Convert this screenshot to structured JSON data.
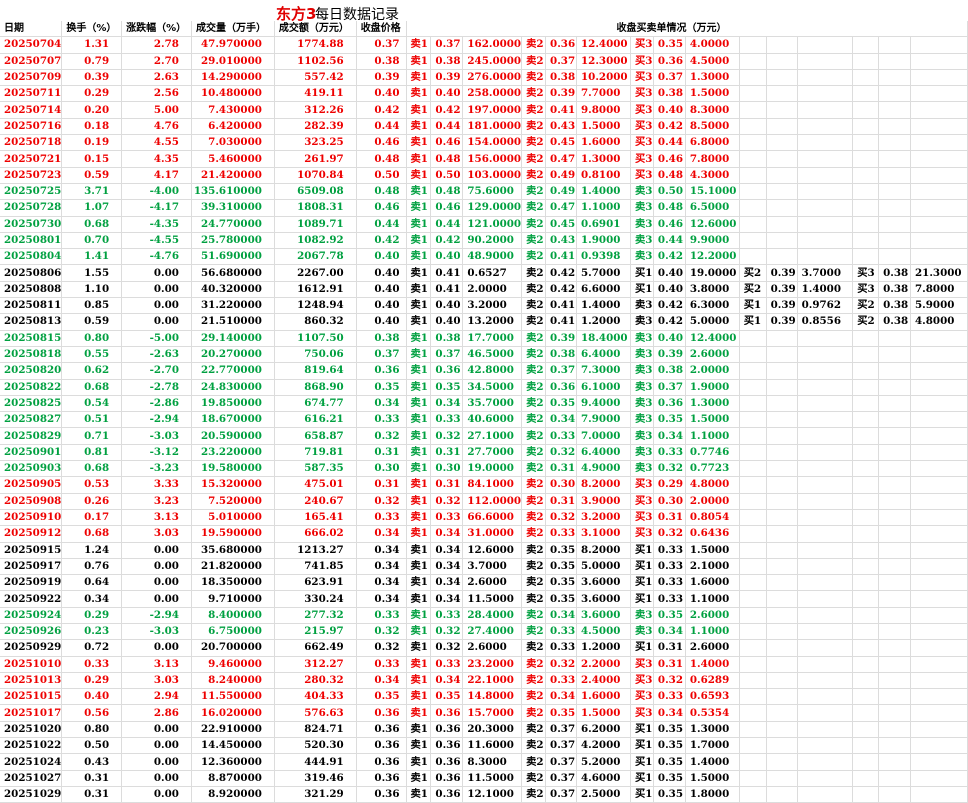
{
  "title": {
    "red": "东方3",
    "black": "每日数据记录"
  },
  "headers": [
    "日期",
    "换手（%）",
    "涨跌幅（%）",
    "成交量（万手）",
    "成交额（万元）",
    "收盘价格",
    "收盘买卖单情况（万元）"
  ],
  "rows": [
    {
      "c": "red",
      "v": [
        "20250704",
        "1.31",
        "2.78",
        "47.970000",
        "1774.88",
        "0.37",
        "卖1",
        "0.37",
        "162.0000",
        "卖2",
        "0.36",
        "12.4000",
        "买3",
        "0.35",
        "4.0000"
      ]
    },
    {
      "c": "red",
      "v": [
        "20250707",
        "0.79",
        "2.70",
        "29.010000",
        "1102.56",
        "0.38",
        "卖1",
        "0.38",
        "245.0000",
        "卖2",
        "0.37",
        "12.3000",
        "买3",
        "0.36",
        "4.5000"
      ]
    },
    {
      "c": "red",
      "v": [
        "20250709",
        "0.39",
        "2.63",
        "14.290000",
        "557.42",
        "0.39",
        "卖1",
        "0.39",
        "276.0000",
        "卖2",
        "0.38",
        "10.2000",
        "买3",
        "0.37",
        "1.3000"
      ]
    },
    {
      "c": "red",
      "v": [
        "20250711",
        "0.29",
        "2.56",
        "10.480000",
        "419.11",
        "0.40",
        "卖1",
        "0.40",
        "258.0000",
        "卖2",
        "0.39",
        "7.7000",
        "买3",
        "0.38",
        "1.5000"
      ]
    },
    {
      "c": "red",
      "v": [
        "20250714",
        "0.20",
        "5.00",
        "7.430000",
        "312.26",
        "0.42",
        "卖1",
        "0.42",
        "197.0000",
        "卖2",
        "0.41",
        "9.8000",
        "买3",
        "0.40",
        "8.3000"
      ]
    },
    {
      "c": "red",
      "v": [
        "20250716",
        "0.18",
        "4.76",
        "6.420000",
        "282.39",
        "0.44",
        "卖1",
        "0.44",
        "181.0000",
        "卖2",
        "0.43",
        "1.5000",
        "买3",
        "0.42",
        "8.5000"
      ]
    },
    {
      "c": "red",
      "v": [
        "20250718",
        "0.19",
        "4.55",
        "7.030000",
        "323.25",
        "0.46",
        "卖1",
        "0.46",
        "154.0000",
        "卖2",
        "0.45",
        "1.6000",
        "买3",
        "0.44",
        "6.8000"
      ]
    },
    {
      "c": "red",
      "v": [
        "20250721",
        "0.15",
        "4.35",
        "5.460000",
        "261.97",
        "0.48",
        "卖1",
        "0.48",
        "156.0000",
        "卖2",
        "0.47",
        "1.3000",
        "买3",
        "0.46",
        "7.8000"
      ]
    },
    {
      "c": "red",
      "v": [
        "20250723",
        "0.59",
        "4.17",
        "21.420000",
        "1070.84",
        "0.50",
        "卖1",
        "0.50",
        "103.0000",
        "卖2",
        "0.49",
        "0.8100",
        "买3",
        "0.48",
        "4.3000"
      ]
    },
    {
      "c": "green",
      "v": [
        "20250725",
        "3.71",
        "-4.00",
        "135.610000",
        "6509.08",
        "0.48",
        "卖1",
        "0.48",
        "75.6000",
        "卖2",
        "0.49",
        "1.4000",
        "卖3",
        "0.50",
        "15.1000"
      ]
    },
    {
      "c": "green",
      "v": [
        "20250728",
        "1.07",
        "-4.17",
        "39.310000",
        "1808.31",
        "0.46",
        "卖1",
        "0.46",
        "129.0000",
        "卖2",
        "0.47",
        "1.1000",
        "卖3",
        "0.48",
        "6.5000"
      ]
    },
    {
      "c": "green",
      "v": [
        "20250730",
        "0.68",
        "-4.35",
        "24.770000",
        "1089.71",
        "0.44",
        "卖1",
        "0.44",
        "121.0000",
        "卖2",
        "0.45",
        "0.6901",
        "卖3",
        "0.46",
        "12.6000"
      ]
    },
    {
      "c": "green",
      "v": [
        "20250801",
        "0.70",
        "-4.55",
        "25.780000",
        "1082.92",
        "0.42",
        "卖1",
        "0.42",
        "90.2000",
        "卖2",
        "0.43",
        "1.9000",
        "卖3",
        "0.44",
        "9.9000"
      ]
    },
    {
      "c": "green",
      "v": [
        "20250804",
        "1.41",
        "-4.76",
        "51.690000",
        "2067.78",
        "0.40",
        "卖1",
        "0.40",
        "48.9000",
        "卖2",
        "0.41",
        "0.9398",
        "卖3",
        "0.42",
        "12.2000"
      ]
    },
    {
      "c": "black",
      "v": [
        "20250806",
        "1.55",
        "0.00",
        "56.680000",
        "2267.00",
        "0.40",
        "卖1",
        "0.41",
        "0.6527",
        "卖2",
        "0.42",
        "5.7000",
        "买1",
        "0.40",
        "19.0000",
        "买2",
        "0.39",
        "3.7000",
        "买3",
        "0.38",
        "21.3000"
      ]
    },
    {
      "c": "black",
      "v": [
        "20250808",
        "1.10",
        "0.00",
        "40.320000",
        "1612.91",
        "0.40",
        "卖1",
        "0.41",
        "2.0000",
        "卖2",
        "0.42",
        "6.6000",
        "买1",
        "0.40",
        "3.8000",
        "买2",
        "0.39",
        "1.4000",
        "买3",
        "0.38",
        "7.8000"
      ]
    },
    {
      "c": "black",
      "v": [
        "20250811",
        "0.85",
        "0.00",
        "31.220000",
        "1248.94",
        "0.40",
        "卖1",
        "0.40",
        "3.2000",
        "卖2",
        "0.41",
        "1.4000",
        "卖3",
        "0.42",
        "6.3000",
        "买1",
        "0.39",
        "0.9762",
        "买2",
        "0.38",
        "5.9000"
      ]
    },
    {
      "c": "black",
      "v": [
        "20250813",
        "0.59",
        "0.00",
        "21.510000",
        "860.32",
        "0.40",
        "卖1",
        "0.40",
        "13.2000",
        "卖2",
        "0.41",
        "1.2000",
        "卖3",
        "0.42",
        "5.0000",
        "买1",
        "0.39",
        "0.8556",
        "买2",
        "0.38",
        "4.8000"
      ]
    },
    {
      "c": "green",
      "v": [
        "20250815",
        "0.80",
        "-5.00",
        "29.140000",
        "1107.50",
        "0.38",
        "卖1",
        "0.38",
        "17.7000",
        "卖2",
        "0.39",
        "18.4000",
        "卖3",
        "0.40",
        "12.4000"
      ]
    },
    {
      "c": "green",
      "v": [
        "20250818",
        "0.55",
        "-2.63",
        "20.270000",
        "750.06",
        "0.37",
        "卖1",
        "0.37",
        "46.5000",
        "卖2",
        "0.38",
        "6.4000",
        "卖3",
        "0.39",
        "2.6000"
      ]
    },
    {
      "c": "green",
      "v": [
        "20250820",
        "0.62",
        "-2.70",
        "22.770000",
        "819.64",
        "0.36",
        "卖1",
        "0.36",
        "42.8000",
        "卖2",
        "0.37",
        "7.3000",
        "卖3",
        "0.38",
        "2.0000"
      ]
    },
    {
      "c": "green",
      "v": [
        "20250822",
        "0.68",
        "-2.78",
        "24.830000",
        "868.90",
        "0.35",
        "卖1",
        "0.35",
        "34.5000",
        "卖2",
        "0.36",
        "6.1000",
        "卖3",
        "0.37",
        "1.9000"
      ]
    },
    {
      "c": "green",
      "v": [
        "20250825",
        "0.54",
        "-2.86",
        "19.850000",
        "674.77",
        "0.34",
        "卖1",
        "0.34",
        "35.7000",
        "卖2",
        "0.35",
        "9.4000",
        "卖3",
        "0.36",
        "1.3000"
      ]
    },
    {
      "c": "green",
      "v": [
        "20250827",
        "0.51",
        "-2.94",
        "18.670000",
        "616.21",
        "0.33",
        "卖1",
        "0.33",
        "40.6000",
        "卖2",
        "0.34",
        "7.9000",
        "卖3",
        "0.35",
        "1.5000"
      ]
    },
    {
      "c": "green",
      "v": [
        "20250829",
        "0.71",
        "-3.03",
        "20.590000",
        "658.87",
        "0.32",
        "卖1",
        "0.32",
        "27.1000",
        "卖2",
        "0.33",
        "7.0000",
        "卖3",
        "0.34",
        "1.1000"
      ]
    },
    {
      "c": "green",
      "v": [
        "20250901",
        "0.81",
        "-3.12",
        "23.220000",
        "719.81",
        "0.31",
        "卖1",
        "0.31",
        "27.7000",
        "卖2",
        "0.32",
        "6.4000",
        "卖3",
        "0.33",
        "0.7746"
      ]
    },
    {
      "c": "green",
      "v": [
        "20250903",
        "0.68",
        "-3.23",
        "19.580000",
        "587.35",
        "0.30",
        "卖1",
        "0.30",
        "19.0000",
        "卖2",
        "0.31",
        "4.9000",
        "卖3",
        "0.32",
        "0.7723"
      ]
    },
    {
      "c": "red",
      "v": [
        "20250905",
        "0.53",
        "3.33",
        "15.320000",
        "475.01",
        "0.31",
        "卖1",
        "0.31",
        "84.1000",
        "卖2",
        "0.30",
        "8.2000",
        "买3",
        "0.29",
        "4.8000"
      ]
    },
    {
      "c": "red",
      "v": [
        "20250908",
        "0.26",
        "3.23",
        "7.520000",
        "240.67",
        "0.32",
        "卖1",
        "0.32",
        "112.0000",
        "卖2",
        "0.31",
        "3.9000",
        "买3",
        "0.30",
        "2.0000"
      ]
    },
    {
      "c": "red",
      "v": [
        "20250910",
        "0.17",
        "3.13",
        "5.010000",
        "165.41",
        "0.33",
        "卖1",
        "0.33",
        "66.6000",
        "卖2",
        "0.32",
        "3.2000",
        "买3",
        "0.31",
        "0.8054"
      ]
    },
    {
      "c": "red",
      "v": [
        "20250912",
        "0.68",
        "3.03",
        "19.590000",
        "666.02",
        "0.34",
        "卖1",
        "0.34",
        "31.0000",
        "卖2",
        "0.33",
        "3.1000",
        "买3",
        "0.32",
        "0.6436"
      ]
    },
    {
      "c": "black",
      "v": [
        "20250915",
        "1.24",
        "0.00",
        "35.680000",
        "1213.27",
        "0.34",
        "卖1",
        "0.34",
        "12.6000",
        "卖2",
        "0.35",
        "8.2000",
        "买1",
        "0.33",
        "1.5000"
      ]
    },
    {
      "c": "black",
      "v": [
        "20250917",
        "0.76",
        "0.00",
        "21.820000",
        "741.85",
        "0.34",
        "卖1",
        "0.34",
        "3.7000",
        "卖2",
        "0.35",
        "5.0000",
        "买1",
        "0.33",
        "2.1000"
      ]
    },
    {
      "c": "black",
      "v": [
        "20250919",
        "0.64",
        "0.00",
        "18.350000",
        "623.91",
        "0.34",
        "卖1",
        "0.34",
        "2.6000",
        "卖2",
        "0.35",
        "3.6000",
        "买1",
        "0.33",
        "1.6000"
      ]
    },
    {
      "c": "black",
      "v": [
        "20250922",
        "0.34",
        "0.00",
        "9.710000",
        "330.24",
        "0.34",
        "卖1",
        "0.34",
        "11.5000",
        "卖2",
        "0.35",
        "3.6000",
        "买1",
        "0.33",
        "1.1000"
      ]
    },
    {
      "c": "green",
      "v": [
        "20250924",
        "0.29",
        "-2.94",
        "8.400000",
        "277.32",
        "0.33",
        "卖1",
        "0.33",
        "28.4000",
        "卖2",
        "0.34",
        "3.6000",
        "卖3",
        "0.35",
        "2.6000"
      ]
    },
    {
      "c": "green",
      "v": [
        "20250926",
        "0.23",
        "-3.03",
        "6.750000",
        "215.97",
        "0.32",
        "卖1",
        "0.32",
        "27.4000",
        "卖2",
        "0.33",
        "4.5000",
        "卖3",
        "0.34",
        "1.1000"
      ]
    },
    {
      "c": "black",
      "v": [
        "20250929",
        "0.72",
        "0.00",
        "20.700000",
        "662.49",
        "0.32",
        "卖1",
        "0.32",
        "2.6000",
        "卖2",
        "0.33",
        "1.2000",
        "买1",
        "0.31",
        "2.6000"
      ]
    },
    {
      "c": "red",
      "v": [
        "20251010",
        "0.33",
        "3.13",
        "9.460000",
        "312.27",
        "0.33",
        "卖1",
        "0.33",
        "23.2000",
        "卖2",
        "0.32",
        "2.2000",
        "买3",
        "0.31",
        "1.4000"
      ]
    },
    {
      "c": "red",
      "v": [
        "20251013",
        "0.29",
        "3.03",
        "8.240000",
        "280.32",
        "0.34",
        "卖1",
        "0.34",
        "22.1000",
        "卖2",
        "0.33",
        "2.4000",
        "买3",
        "0.32",
        "0.6289"
      ]
    },
    {
      "c": "red",
      "v": [
        "20251015",
        "0.40",
        "2.94",
        "11.550000",
        "404.33",
        "0.35",
        "卖1",
        "0.35",
        "14.8000",
        "卖2",
        "0.34",
        "1.6000",
        "买3",
        "0.33",
        "0.6593"
      ]
    },
    {
      "c": "red",
      "v": [
        "20251017",
        "0.56",
        "2.86",
        "16.020000",
        "576.63",
        "0.36",
        "卖1",
        "0.36",
        "15.7000",
        "卖2",
        "0.35",
        "1.5000",
        "买3",
        "0.34",
        "0.5354"
      ]
    },
    {
      "c": "black",
      "v": [
        "20251020",
        "0.80",
        "0.00",
        "22.910000",
        "824.71",
        "0.36",
        "卖1",
        "0.36",
        "20.3000",
        "卖2",
        "0.37",
        "6.2000",
        "买1",
        "0.35",
        "1.3000"
      ]
    },
    {
      "c": "black",
      "v": [
        "20251022",
        "0.50",
        "0.00",
        "14.450000",
        "520.30",
        "0.36",
        "卖1",
        "0.36",
        "11.6000",
        "卖2",
        "0.37",
        "4.2000",
        "买1",
        "0.35",
        "1.7000"
      ]
    },
    {
      "c": "black",
      "v": [
        "20251024",
        "0.43",
        "0.00",
        "12.360000",
        "444.91",
        "0.36",
        "卖1",
        "0.36",
        "8.3000",
        "卖2",
        "0.37",
        "5.2000",
        "买1",
        "0.35",
        "1.4000"
      ]
    },
    {
      "c": "black",
      "v": [
        "20251027",
        "0.31",
        "0.00",
        "8.870000",
        "319.46",
        "0.36",
        "卖1",
        "0.36",
        "11.5000",
        "卖2",
        "0.37",
        "4.6000",
        "买1",
        "0.35",
        "1.5000"
      ]
    },
    {
      "c": "black",
      "v": [
        "20251029",
        "0.31",
        "0.00",
        "8.920000",
        "321.29",
        "0.36",
        "卖1",
        "0.36",
        "12.1000",
        "卖2",
        "0.37",
        "2.5000",
        "买1",
        "0.35",
        "1.8000"
      ]
    }
  ]
}
